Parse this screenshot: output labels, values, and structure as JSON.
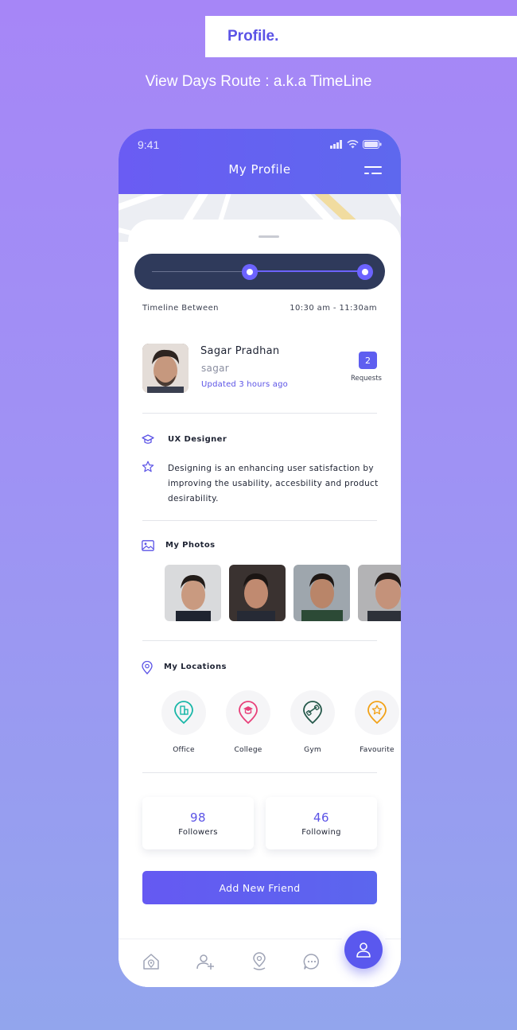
{
  "banner": {
    "title": "Profile."
  },
  "subtitle": "View Days Route : a.k.a TimeLine",
  "status_bar": {
    "time": "9:41"
  },
  "header": {
    "title": "My Profile"
  },
  "timeline": {
    "label": "Timeline Between",
    "range": "10:30 am - 11:30am"
  },
  "profile": {
    "name": "Sagar Pradhan",
    "username": "sagar",
    "updated": "Updated 3 hours ago",
    "requests_count": "2",
    "requests_label": "Requests"
  },
  "about": {
    "title": "UX Designer",
    "bio": "Designing is an enhancing user satisfaction by improving the usability, accesbility and product desirability."
  },
  "photos": {
    "title": "My Photos",
    "count": 4
  },
  "locations": {
    "title": "My Locations",
    "items": [
      {
        "label": "Office",
        "icon": "office-pin-icon",
        "color": "#19b7a8"
      },
      {
        "label": "College",
        "icon": "college-pin-icon",
        "color": "#e8407a"
      },
      {
        "label": "Gym",
        "icon": "gym-pin-icon",
        "color": "#24584a"
      },
      {
        "label": "Favourite",
        "icon": "favourite-pin-icon",
        "color": "#f2a218"
      }
    ]
  },
  "stats": {
    "followers_value": "98",
    "followers_label": "Followers",
    "following_value": "46",
    "following_label": "Following"
  },
  "add_friend_label": "Add New Friend",
  "colors": {
    "accent": "#5b53e6",
    "header": "#6a5cf3",
    "timeline_bg": "#2f3a5b"
  },
  "bottom_nav": [
    "home-icon",
    "add-user-icon",
    "location-icon",
    "chat-icon",
    "profile-icon"
  ]
}
